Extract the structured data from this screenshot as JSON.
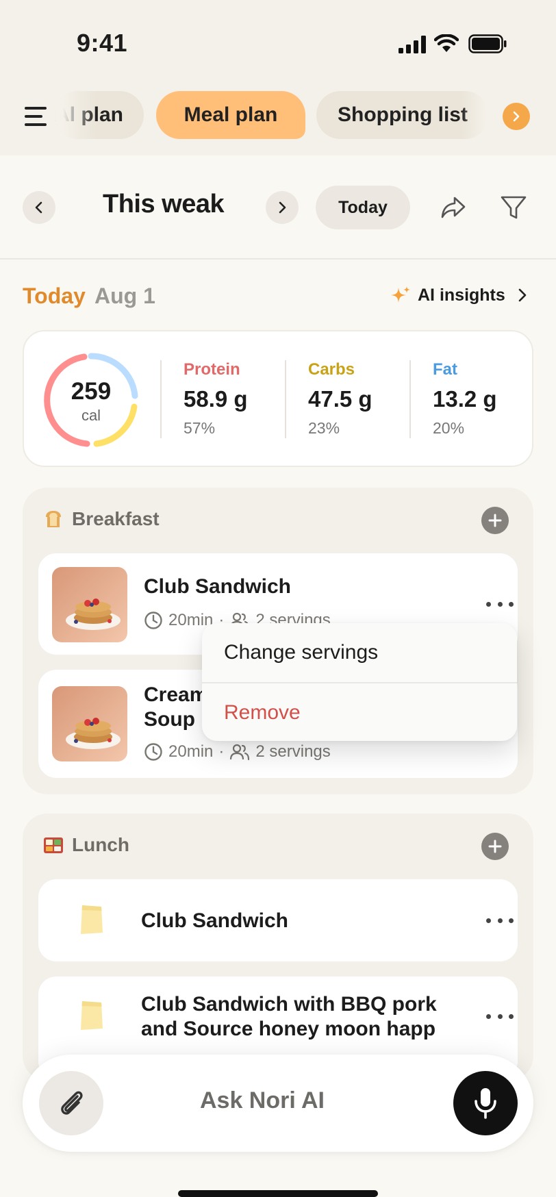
{
  "status_bar": {
    "time": "9:41"
  },
  "tabs": {
    "prev_label": "Al plan",
    "active_label": "Meal plan",
    "next_label": "Shopping list"
  },
  "week": {
    "title": "This weak",
    "today_button": "Today"
  },
  "date_row": {
    "today_label": "Today",
    "date": "Aug 1",
    "ai_insights": "AI insights"
  },
  "nutrition": {
    "calories": "259",
    "calories_unit": "cal",
    "macros": [
      {
        "name": "Protein",
        "value": "58.9 g",
        "percent": "57%",
        "color": "#e36868"
      },
      {
        "name": "Carbs",
        "value": "47.5 g",
        "percent": "23%",
        "color": "#c9a316"
      },
      {
        "name": "Fat",
        "value": "13.2 g",
        "percent": "20%",
        "color": "#4a9be0"
      }
    ],
    "ring_colors": [
      "#ff8f8f",
      "#b9dcff",
      "#ffe066"
    ]
  },
  "breakfast": {
    "title": "Breakfast",
    "icon": "bread-icon",
    "items": [
      {
        "name": "Club Sandwich",
        "time": "20min",
        "servings": "2 servings"
      },
      {
        "name_line1": "Cream",
        "name_line2": "Soup",
        "time": "20min",
        "servings": "2 servings"
      }
    ]
  },
  "lunch": {
    "title": "Lunch",
    "icon": "bento-icon",
    "items": [
      {
        "name": "Club Sandwich"
      },
      {
        "name_line1": "Club Sandwich with BBQ pork",
        "name_line2": "and Source honey moon happ"
      }
    ]
  },
  "popup_menu": {
    "change_servings": "Change servings",
    "remove": "Remove"
  },
  "ask_bar": {
    "placeholder": "Ask Nori AI"
  },
  "colors": {
    "accent_orange": "#ffbf78",
    "today_orange": "#e08a2c",
    "remove_red": "#d2504a"
  }
}
